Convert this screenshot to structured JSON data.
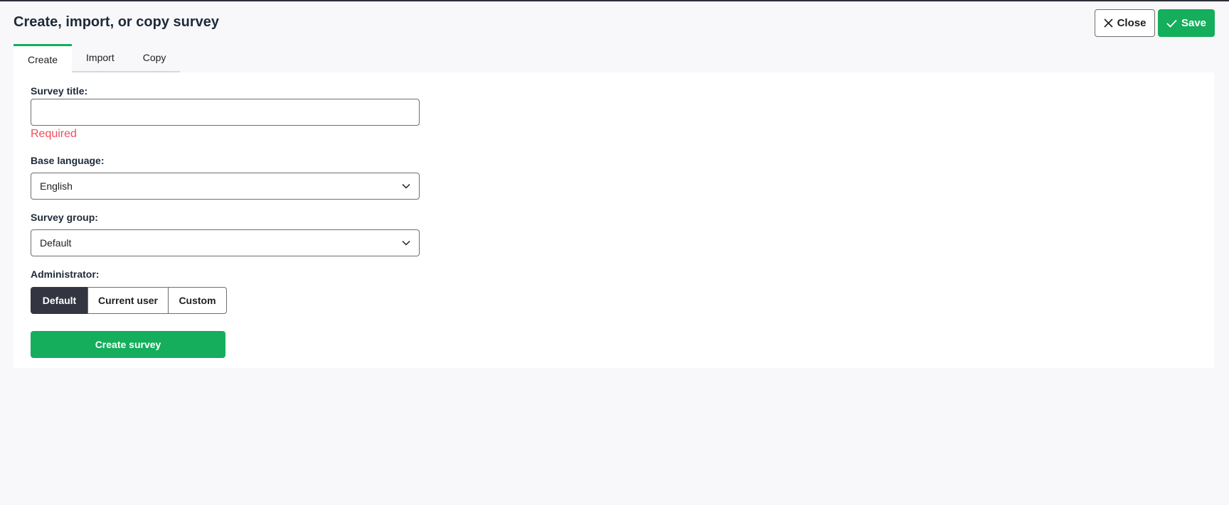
{
  "header": {
    "title": "Create, import, or copy survey",
    "close_label": "Close",
    "save_label": "Save",
    "close_icon": "close-icon",
    "save_icon": "check-icon"
  },
  "tabs": [
    {
      "label": "Create",
      "active": true
    },
    {
      "label": "Import",
      "active": false
    },
    {
      "label": "Copy",
      "active": false
    }
  ],
  "form": {
    "survey_title": {
      "label": "Survey title:",
      "value": "",
      "error": "Required"
    },
    "base_language": {
      "label": "Base language:",
      "value": "English"
    },
    "survey_group": {
      "label": "Survey group:",
      "value": "Default"
    },
    "administrator": {
      "label": "Administrator:",
      "options": [
        "Default",
        "Current user",
        "Custom"
      ],
      "selected": "Default"
    },
    "submit_label": "Create survey"
  },
  "colors": {
    "accent": "#14ae5c",
    "error": "#ee4e5c",
    "dark": "#333641"
  }
}
